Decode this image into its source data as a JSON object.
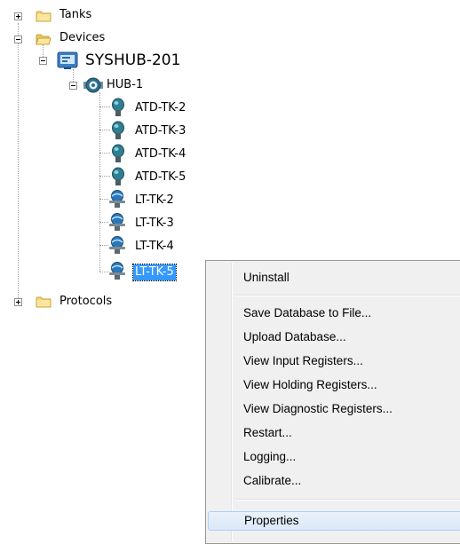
{
  "tree": {
    "tanks": "Tanks",
    "devices": "Devices",
    "syshub": "SYSHUB-201",
    "hub": "HUB-1",
    "devices_list": [
      "ATD-TK-2",
      "ATD-TK-3",
      "ATD-TK-4",
      "ATD-TK-5",
      "LT-TK-2",
      "LT-TK-3",
      "LT-TK-4",
      "LT-TK-5"
    ],
    "protocols": "Protocols"
  },
  "context_menu": {
    "uninstall": "Uninstall",
    "save_db": "Save Database to File...",
    "upload_db": "Upload Database...",
    "view_input": "View Input Registers...",
    "view_holding": "View Holding Registers...",
    "view_diag": "View Diagnostic Registers...",
    "restart": "Restart...",
    "logging": "Logging...",
    "calibrate": "Calibrate...",
    "properties": "Properties"
  },
  "colors": {
    "selection": "#3399ff",
    "folder": "#f2d879",
    "device_blue": "#1f6fa8",
    "menu_bg": "#f0f0f0"
  }
}
